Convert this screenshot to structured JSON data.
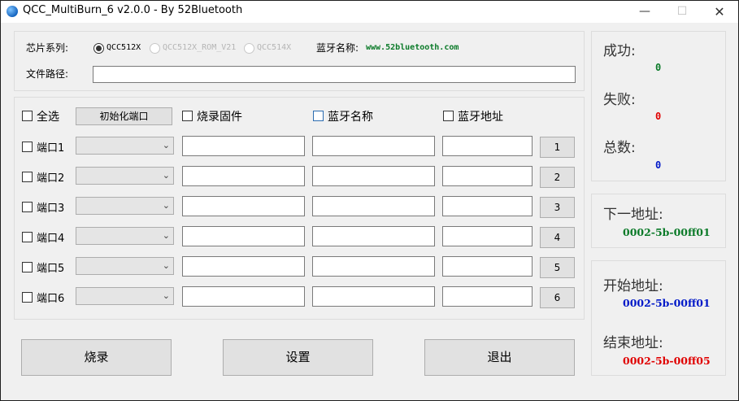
{
  "window": {
    "title": "QCC_MultiBurn_6 v2.0.0 - By 52Bluetooth",
    "minimize": "—",
    "maximize": "☐",
    "close": "✕"
  },
  "config": {
    "chip_label": "芯片系列:",
    "chip_options": [
      {
        "label": "QCC512X",
        "selected": true,
        "enabled": true
      },
      {
        "label": "QCC512X_ROM_V21",
        "selected": false,
        "enabled": false
      },
      {
        "label": "QCC514X",
        "selected": false,
        "enabled": false
      }
    ],
    "bt_name_label": "蓝牙名称:",
    "bt_name_value": "www.52bluetooth.com",
    "file_path_label": "文件路径:",
    "file_path_value": ""
  },
  "ports_header": {
    "select_all": "全选",
    "init_ports": "初始化端口",
    "burn_firmware": "烧录固件",
    "bt_name": "蓝牙名称",
    "bt_address": "蓝牙地址"
  },
  "ports": [
    {
      "label": "端口1",
      "button": "1"
    },
    {
      "label": "端口2",
      "button": "2"
    },
    {
      "label": "端口3",
      "button": "3"
    },
    {
      "label": "端口4",
      "button": "4"
    },
    {
      "label": "端口5",
      "button": "5"
    },
    {
      "label": "端口6",
      "button": "6"
    }
  ],
  "actions": {
    "burn": "烧录",
    "settings": "设置",
    "exit": "退出"
  },
  "stats": {
    "success_label": "成功:",
    "success_value": "0",
    "fail_label": "失败:",
    "fail_value": "0",
    "total_label": "总数:",
    "total_value": "0"
  },
  "addresses": {
    "next_label": "下一地址:",
    "next_value": "0002-5b-00ff01",
    "start_label": "开始地址:",
    "start_value": "0002-5b-00ff01",
    "end_label": "结束地址:",
    "end_value": "0002-5b-00ff05"
  },
  "colors": {
    "success": "#0a7a28",
    "fail": "#e00000",
    "total": "#0018c8",
    "next": "#0a7a28",
    "start": "#0018c8",
    "end": "#e00000"
  }
}
